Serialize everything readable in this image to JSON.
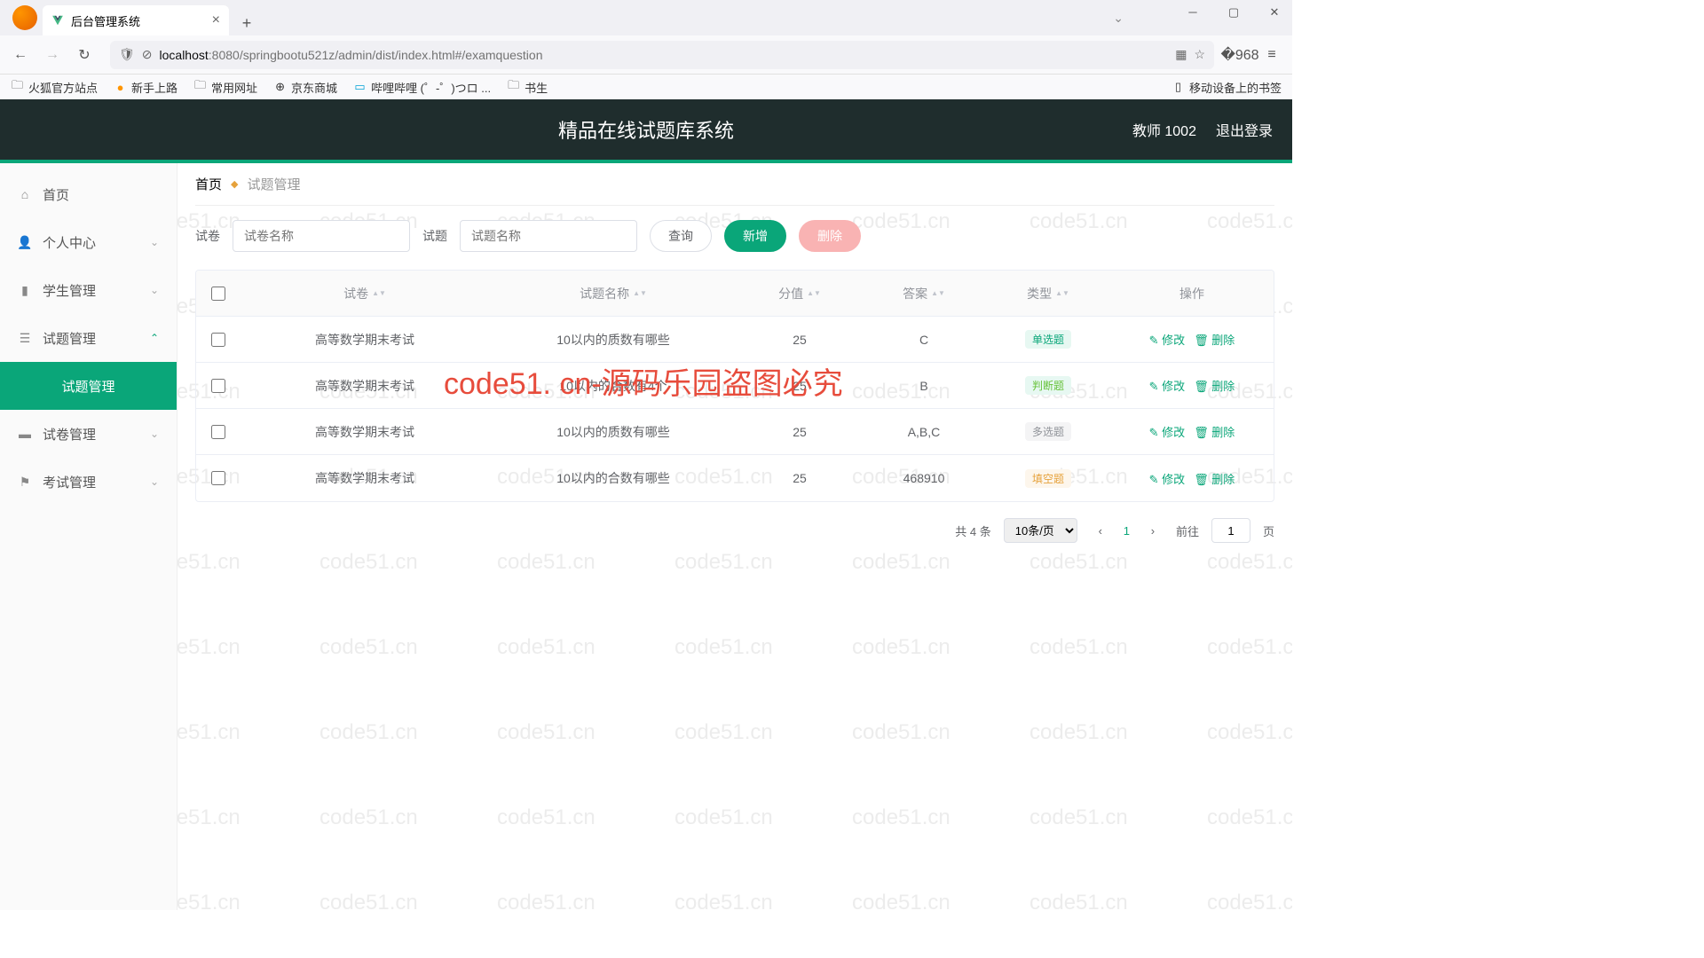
{
  "browser": {
    "tab_title": "后台管理系统",
    "url_host": "localhost",
    "url_port": ":8080",
    "url_path": "/springbootu521z/admin/dist/index.html#/examquestion",
    "bookmarks": [
      "火狐官方站点",
      "新手上路",
      "常用网址",
      "京东商城",
      "哔哩哔哩 (゜-゜)つロ ...",
      "书生"
    ],
    "bookmarks_right": "移动设备上的书签"
  },
  "header": {
    "title": "精品在线试题库系统",
    "user": "教师 1002",
    "logout": "退出登录"
  },
  "sidebar": {
    "home": "首页",
    "items": [
      {
        "label": "个人中心"
      },
      {
        "label": "学生管理"
      },
      {
        "label": "试题管理",
        "expanded": true
      },
      {
        "label": "试卷管理"
      },
      {
        "label": "考试管理"
      }
    ],
    "active_sub": "试题管理"
  },
  "crumb": {
    "home": "首页",
    "current": "试题管理"
  },
  "filter": {
    "label1": "试卷",
    "placeholder1": "试卷名称",
    "label2": "试题",
    "placeholder2": "试题名称",
    "search": "查询",
    "add": "新增",
    "del": "删除"
  },
  "table": {
    "headers": [
      "试卷",
      "试题名称",
      "分值",
      "答案",
      "类型",
      "操作"
    ],
    "rows": [
      {
        "exam": "高等数学期末考试",
        "question": "10以内的质数有哪些",
        "score": "25",
        "answer": "C",
        "type": "单选题",
        "tag": "t1"
      },
      {
        "exam": "高等数学期末考试",
        "question": "10以内的合数有4个",
        "score": "25",
        "answer": "B",
        "type": "判断题",
        "tag": "t2"
      },
      {
        "exam": "高等数学期末考试",
        "question": "10以内的质数有哪些",
        "score": "25",
        "answer": "A,B,C",
        "type": "多选题",
        "tag": "t3"
      },
      {
        "exam": "高等数学期末考试",
        "question": "10以内的合数有哪些",
        "score": "25",
        "answer": "468910",
        "type": "填空题",
        "tag": "t4"
      }
    ],
    "edit": "修改",
    "delete": "删除"
  },
  "pager": {
    "total": "共 4 条",
    "size": "10条/页",
    "current": "1",
    "goto": "前往",
    "page_input": "1",
    "page_suffix": "页"
  },
  "watermark_text": "code51.cn",
  "watermark_center": "code51. cn-源码乐园盗图必究"
}
